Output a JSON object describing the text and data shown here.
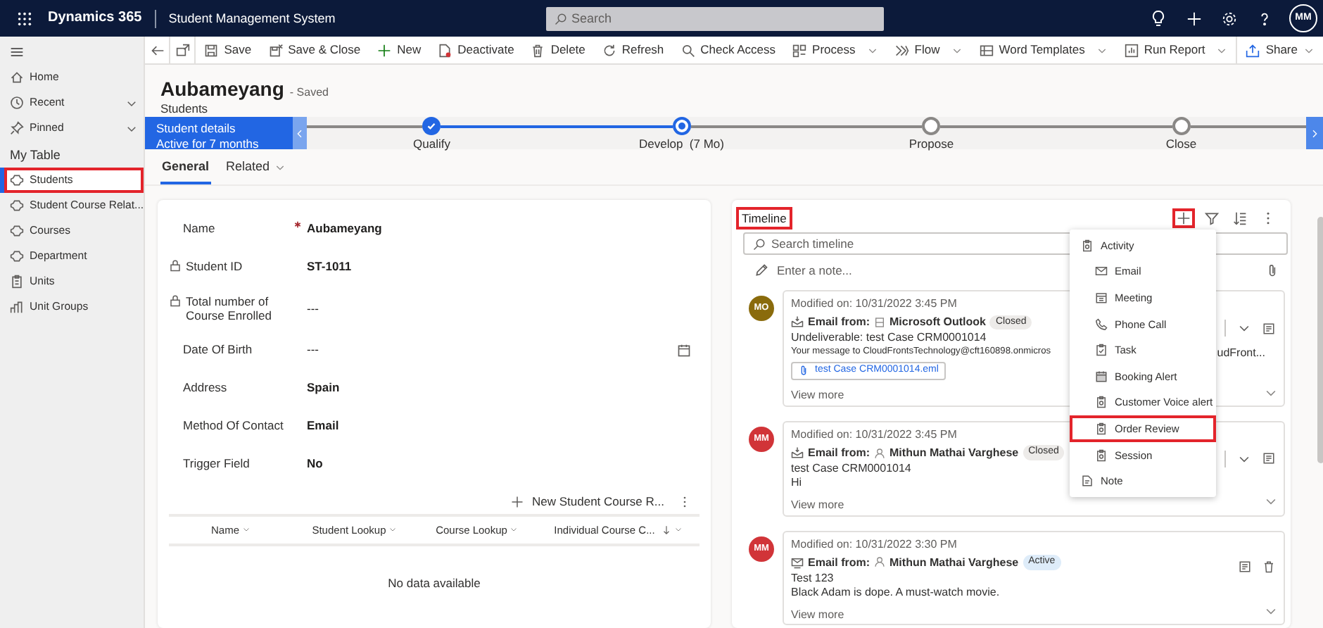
{
  "app": {
    "brand": "Dynamics 365",
    "title": "Student Management System",
    "search_placeholder": "Search",
    "user_initials": "MM"
  },
  "sidebar": {
    "items": [
      {
        "label": "Home",
        "kind": "home",
        "expandable": false
      },
      {
        "label": "Recent",
        "kind": "recent",
        "expandable": true
      },
      {
        "label": "Pinned",
        "kind": "pinned",
        "expandable": true
      }
    ],
    "section": "My Table",
    "table_items": [
      {
        "label": "Students",
        "kind": "entity",
        "selected": true,
        "highlighted": true
      },
      {
        "label": "Student Course Relat...",
        "kind": "entity",
        "selected": false,
        "highlighted": false
      },
      {
        "label": "Courses",
        "kind": "entity",
        "selected": false,
        "highlighted": false
      },
      {
        "label": "Department",
        "kind": "entity",
        "selected": false,
        "highlighted": false
      },
      {
        "label": "Units",
        "kind": "units",
        "selected": false,
        "highlighted": false
      },
      {
        "label": "Unit Groups",
        "kind": "unit-groups",
        "selected": false,
        "highlighted": false
      }
    ]
  },
  "commands": [
    {
      "label": "Save",
      "kind": "save",
      "dropdown": false
    },
    {
      "label": "Save & Close",
      "kind": "save-close",
      "dropdown": false
    },
    {
      "label": "New",
      "kind": "new",
      "dropdown": false
    },
    {
      "label": "Deactivate",
      "kind": "deactivate",
      "dropdown": false
    },
    {
      "label": "Delete",
      "kind": "delete",
      "dropdown": false
    },
    {
      "label": "Refresh",
      "kind": "refresh",
      "dropdown": false
    },
    {
      "label": "Check Access",
      "kind": "check-access",
      "dropdown": false
    },
    {
      "label": "Process",
      "kind": "process",
      "dropdown": true
    },
    {
      "label": "Flow",
      "kind": "flow",
      "dropdown": true
    },
    {
      "label": "Word Templates",
      "kind": "word-templates",
      "dropdown": true
    },
    {
      "label": "Run Report",
      "kind": "run-report",
      "dropdown": true
    }
  ],
  "share": {
    "label": "Share",
    "dropdown": true
  },
  "record": {
    "name": "Aubameyang",
    "save_status": "- Saved",
    "entity": "Students"
  },
  "process": {
    "active_stage": {
      "title": "Student details",
      "subtitle": "Active for 7 months"
    },
    "stages": [
      {
        "label": "Qualify",
        "completed": true,
        "current": false
      },
      {
        "label": "Develop  (7 Mo)",
        "completed": false,
        "current": true
      },
      {
        "label": "Propose",
        "completed": false,
        "current": false
      },
      {
        "label": "Close",
        "completed": false,
        "current": false
      }
    ]
  },
  "tabs": [
    {
      "label": "General",
      "selected": true,
      "dropdown": false
    },
    {
      "label": "Related",
      "selected": false,
      "dropdown": true
    }
  ],
  "form": {
    "fields": [
      {
        "label": "Name",
        "value": "Aubameyang",
        "required": true,
        "locked": false,
        "kind": "text",
        "bold": true
      },
      {
        "label": "Student ID",
        "value": "ST-1011",
        "required": false,
        "locked": true,
        "kind": "text",
        "bold": true
      },
      {
        "label": "Total number of Course Enrolled",
        "value": "---",
        "required": false,
        "locked": true,
        "kind": "text",
        "bold": false
      },
      {
        "label": "Date Of Birth",
        "value": "---",
        "required": false,
        "locked": false,
        "kind": "date",
        "bold": false
      },
      {
        "label": "Address",
        "value": "Spain",
        "required": false,
        "locked": false,
        "kind": "text",
        "bold": true
      },
      {
        "label": "Method Of Contact",
        "value": "Email",
        "required": false,
        "locked": false,
        "kind": "text",
        "bold": true
      },
      {
        "label": "Trigger Field",
        "value": "No",
        "required": false,
        "locked": false,
        "kind": "text",
        "bold": true
      }
    ],
    "subgrid": {
      "new_button": "New Student Course R...",
      "columns": [
        {
          "label": "Name",
          "sorted": false
        },
        {
          "label": "Student Lookup",
          "sorted": false
        },
        {
          "label": "Course Lookup",
          "sorted": false
        },
        {
          "label": "Individual Course C...",
          "sorted": true
        }
      ],
      "empty_message": "No data available"
    }
  },
  "timeline": {
    "title": "Timeline",
    "title_highlighted": true,
    "add_highlighted": true,
    "search_placeholder": "Search timeline",
    "note_placeholder": "Enter a note...",
    "entries": [
      {
        "initials": "MO",
        "color": "#8a6b0c",
        "modified": "Modified on: 10/31/2022 3:45 PM",
        "from_label": "Email from:",
        "sender": "Microsoft Outlook",
        "sender_is_user": false,
        "status": "Closed",
        "active": false,
        "lines": [
          "Undeliverable: test Case CRM0001014",
          "Your message to CloudFrontsTechnology@cft160898.onmicros"
        ],
        "line_tail": "udFront...",
        "attachment": "test Case CRM0001014.eml",
        "more": "View more"
      },
      {
        "initials": "MM",
        "color": "#d13438",
        "modified": "Modified on: 10/31/2022 3:45 PM",
        "from_label": "Email from:",
        "sender": "Mithun Mathai Varghese",
        "sender_is_user": true,
        "status": "Closed",
        "active": false,
        "lines": [
          "test Case CRM0001014",
          "Hi"
        ],
        "more": "View more"
      },
      {
        "initials": "MM",
        "color": "#d13438",
        "modified": "Modified on: 10/31/2022 3:30 PM",
        "from_label": "Email from:",
        "sender": "Mithun Mathai Varghese",
        "sender_is_user": true,
        "status": "Active",
        "active": true,
        "lines": [
          "Test 123",
          "Black Adam is dope. A must-watch movie."
        ],
        "more": "View more"
      }
    ],
    "menu": [
      {
        "label": "Activity",
        "kind": "activity",
        "highlighted": false,
        "children": [
          {
            "label": "Email",
            "kind": "email",
            "highlighted": false
          },
          {
            "label": "Meeting",
            "kind": "meeting",
            "highlighted": false
          },
          {
            "label": "Phone Call",
            "kind": "phone",
            "highlighted": false
          },
          {
            "label": "Task",
            "kind": "task",
            "highlighted": false
          },
          {
            "label": "Booking Alert",
            "kind": "booking",
            "highlighted": false
          },
          {
            "label": "Customer Voice alert",
            "kind": "activity",
            "highlighted": false
          },
          {
            "label": "Order Review",
            "kind": "activity",
            "highlighted": true
          },
          {
            "label": "Session",
            "kind": "activity",
            "highlighted": false
          }
        ]
      },
      {
        "label": "Note",
        "kind": "note",
        "highlighted": false
      }
    ]
  }
}
